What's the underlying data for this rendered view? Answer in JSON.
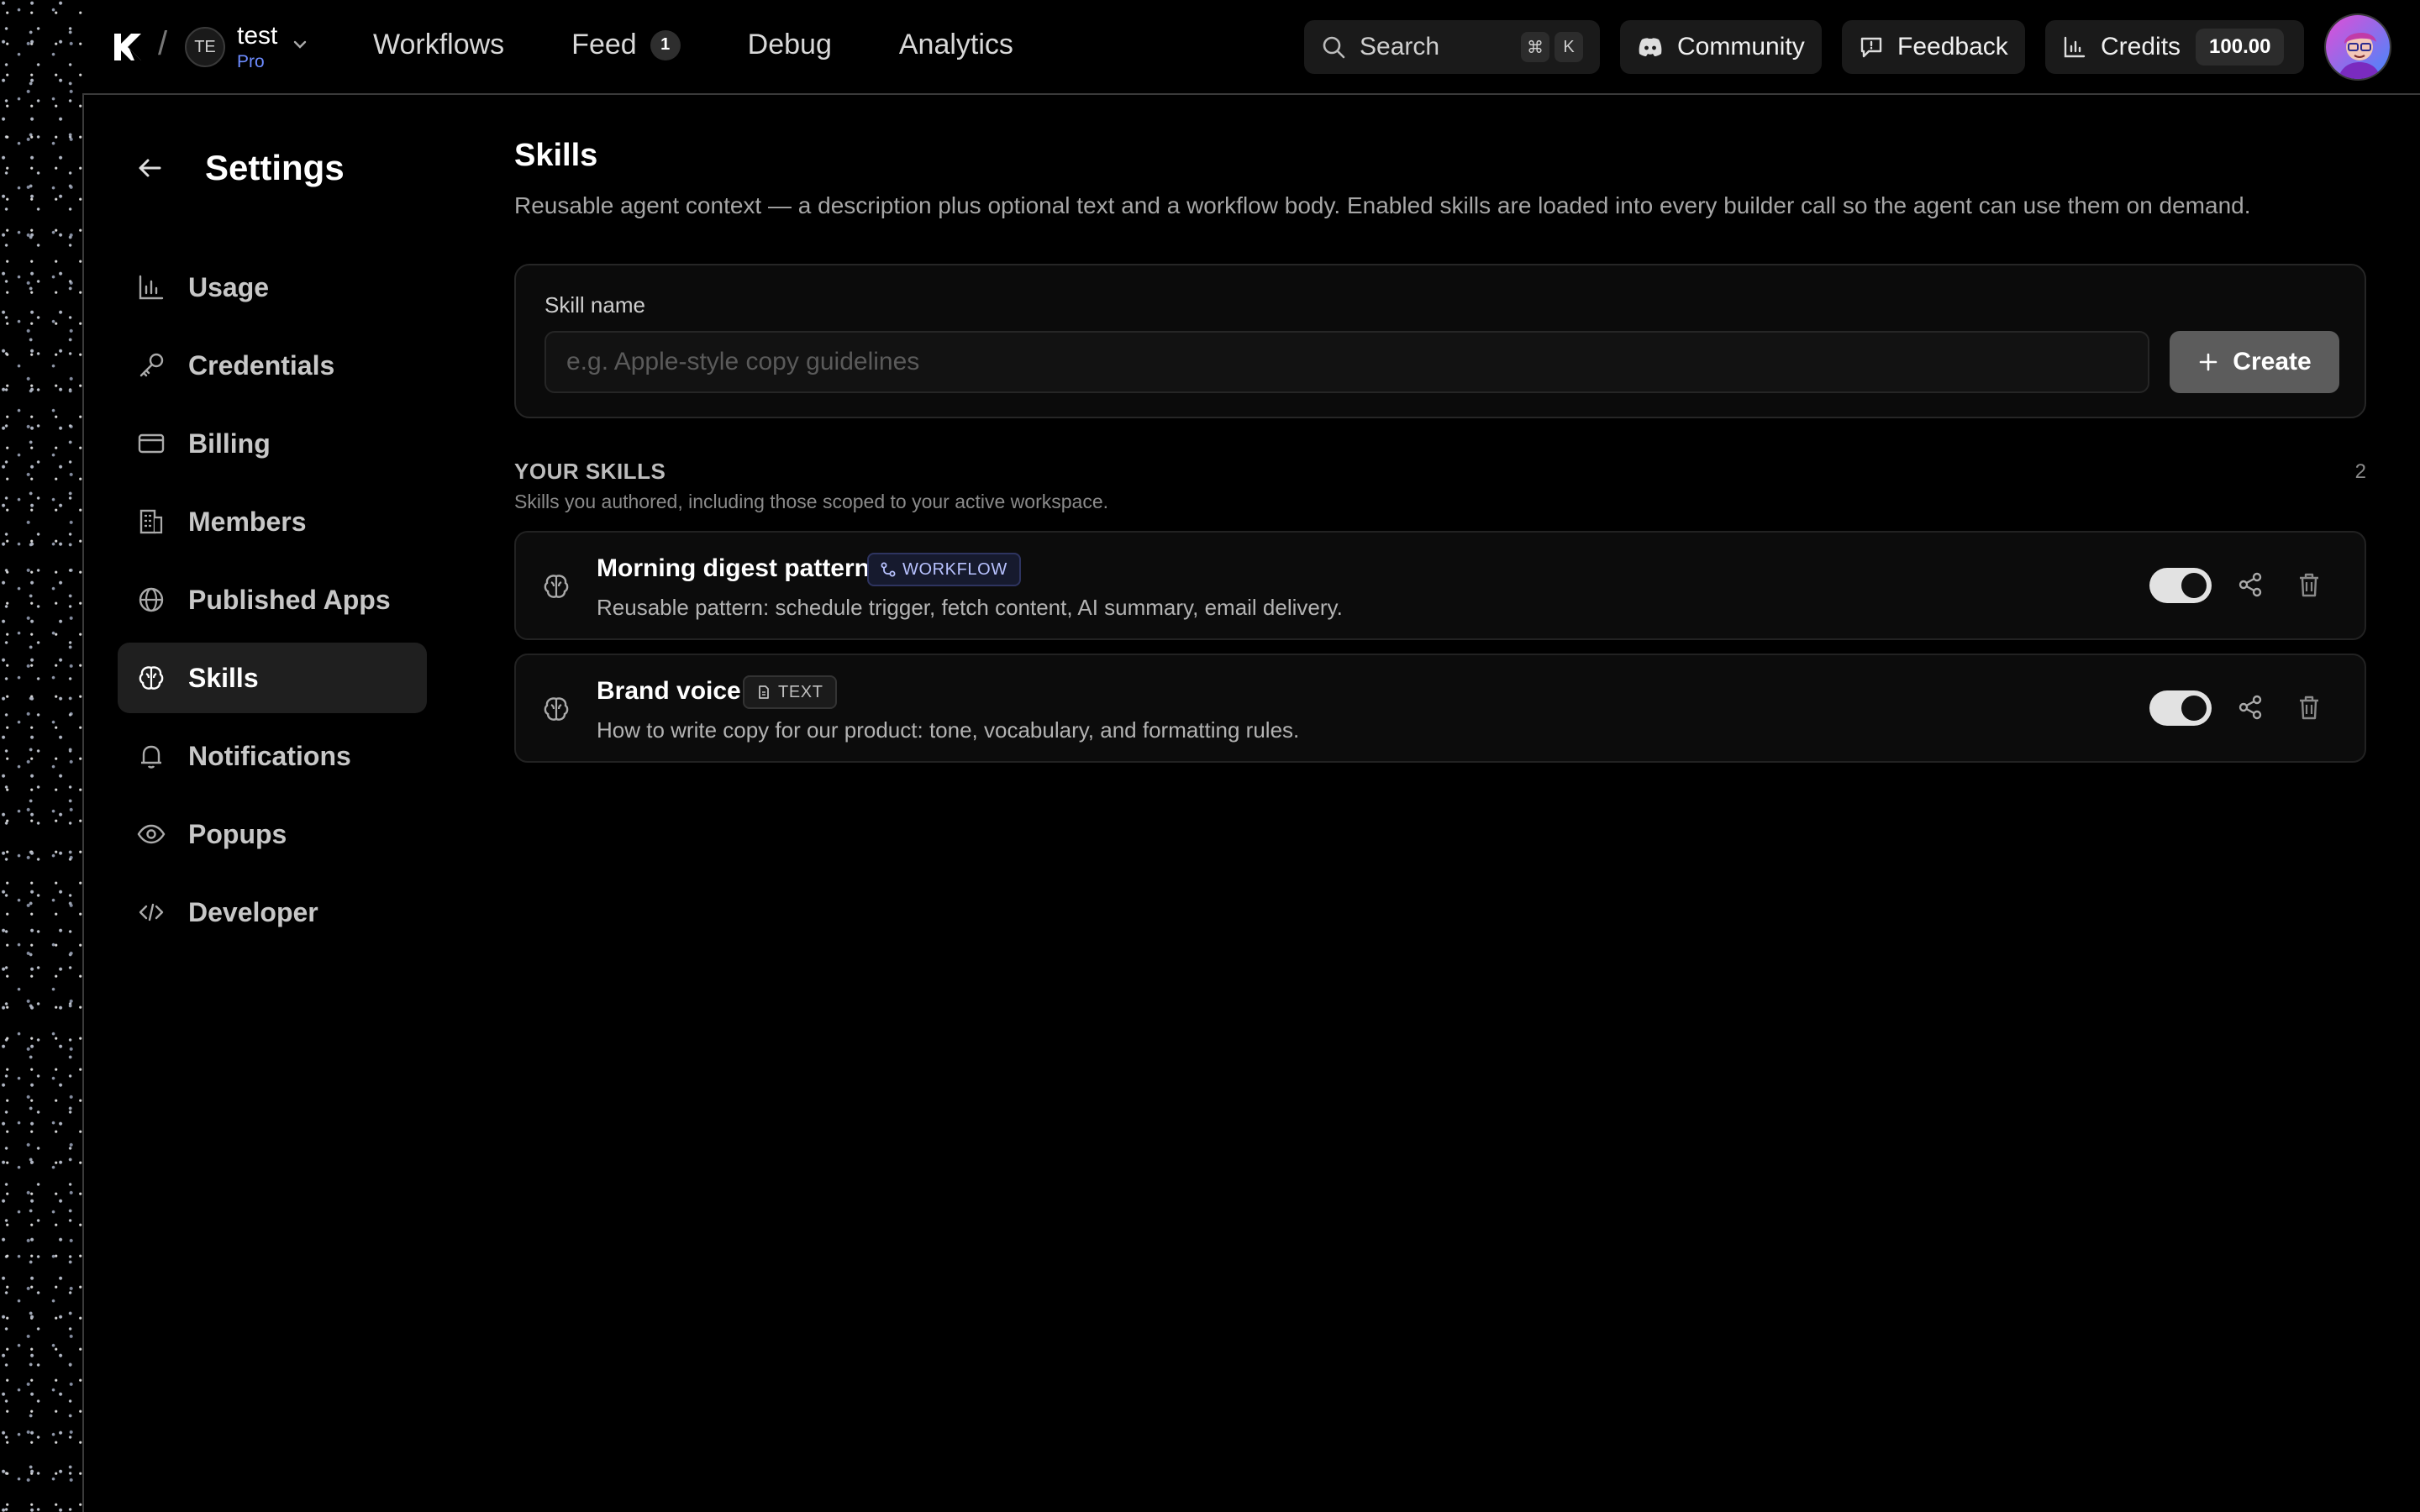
{
  "workspace": {
    "initials": "TE",
    "name": "test",
    "plan": "Pro"
  },
  "nav": {
    "workflows": "Workflows",
    "feed": "Feed",
    "feed_badge": "1",
    "debug": "Debug",
    "analytics": "Analytics"
  },
  "search": {
    "label": "Search",
    "shortcut_mod": "⌘",
    "shortcut_key": "K"
  },
  "topbar": {
    "community": "Community",
    "feedback": "Feedback",
    "credits_label": "Credits",
    "credits_value": "100.00"
  },
  "settings": {
    "title": "Settings",
    "items": [
      {
        "label": "Usage",
        "icon": "bar-chart-icon"
      },
      {
        "label": "Credentials",
        "icon": "key-icon"
      },
      {
        "label": "Billing",
        "icon": "credit-card-icon"
      },
      {
        "label": "Members",
        "icon": "building-icon"
      },
      {
        "label": "Published Apps",
        "icon": "globe-icon"
      },
      {
        "label": "Skills",
        "icon": "brain-icon",
        "active": true
      },
      {
        "label": "Notifications",
        "icon": "bell-icon"
      },
      {
        "label": "Popups",
        "icon": "eye-icon"
      },
      {
        "label": "Developer",
        "icon": "code-icon"
      }
    ]
  },
  "page": {
    "title": "Skills",
    "description": "Reusable agent context — a description plus optional text and a workflow body. Enabled skills are loaded into every builder call so the agent can use them on demand."
  },
  "create_form": {
    "label": "Skill name",
    "placeholder": "e.g. Apple-style copy guidelines",
    "button": "Create"
  },
  "your_skills": {
    "heading": "YOUR SKILLS",
    "subheading": "Skills you authored, including those scoped to your active workspace.",
    "count": "2",
    "items": [
      {
        "name": "Morning digest pattern",
        "tag": "WORKFLOW",
        "description": "Reusable pattern: schedule trigger, fetch content, AI summary, email delivery.",
        "enabled": true
      },
      {
        "name": "Brand voice",
        "tag": "TEXT",
        "description": "How to write copy for our product: tone, vocabulary, and formatting rules.",
        "enabled": true
      }
    ]
  },
  "colors": {
    "background": "#000000",
    "accent": "#6d8cff",
    "workflow_tag": "#b8c2ff",
    "active_item": "#1f1f1f"
  }
}
